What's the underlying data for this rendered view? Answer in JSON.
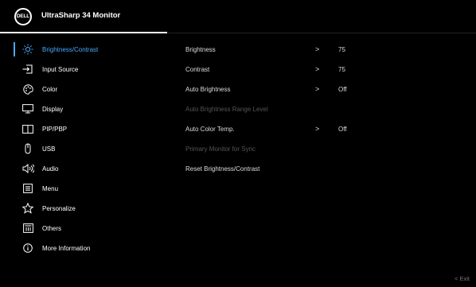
{
  "header": {
    "logo_text": "DELL",
    "title": "UltraSharp 34 Monitor"
  },
  "sidebar": {
    "items": [
      {
        "label": "Brightness/Contrast",
        "icon": "sun-icon",
        "active": true
      },
      {
        "label": "Input Source",
        "icon": "input-source-icon"
      },
      {
        "label": "Color",
        "icon": "palette-icon"
      },
      {
        "label": "Display",
        "icon": "display-icon"
      },
      {
        "label": "PIP/PBP",
        "icon": "pip-pbp-icon"
      },
      {
        "label": "USB",
        "icon": "usb-icon"
      },
      {
        "label": "Audio",
        "icon": "audio-icon"
      },
      {
        "label": "Menu",
        "icon": "menu-icon"
      },
      {
        "label": "Personalize",
        "icon": "star-icon"
      },
      {
        "label": "Others",
        "icon": "others-icon"
      },
      {
        "label": "More Information",
        "icon": "info-icon"
      }
    ]
  },
  "main": {
    "rows": [
      {
        "label": "Brightness",
        "chevron": ">",
        "value": "75",
        "enabled": true
      },
      {
        "label": "Contrast",
        "chevron": ">",
        "value": "75",
        "enabled": true
      },
      {
        "label": "Auto Brightness",
        "chevron": ">",
        "value": "Off",
        "enabled": true
      },
      {
        "label": "Auto Brightness Range Level",
        "chevron": "",
        "value": "",
        "enabled": false
      },
      {
        "label": "Auto Color Temp.",
        "chevron": ">",
        "value": "Off",
        "enabled": true
      },
      {
        "label": "Primary Monitor for Sync",
        "chevron": "",
        "value": "",
        "enabled": false
      },
      {
        "label": "Reset Brightness/Contrast",
        "chevron": "",
        "value": "",
        "enabled": true
      }
    ]
  },
  "footer": {
    "exit_label": "< Exit"
  },
  "colors": {
    "accent": "#4aa8ff",
    "background": "#000000",
    "disabled_text": "#555555"
  }
}
